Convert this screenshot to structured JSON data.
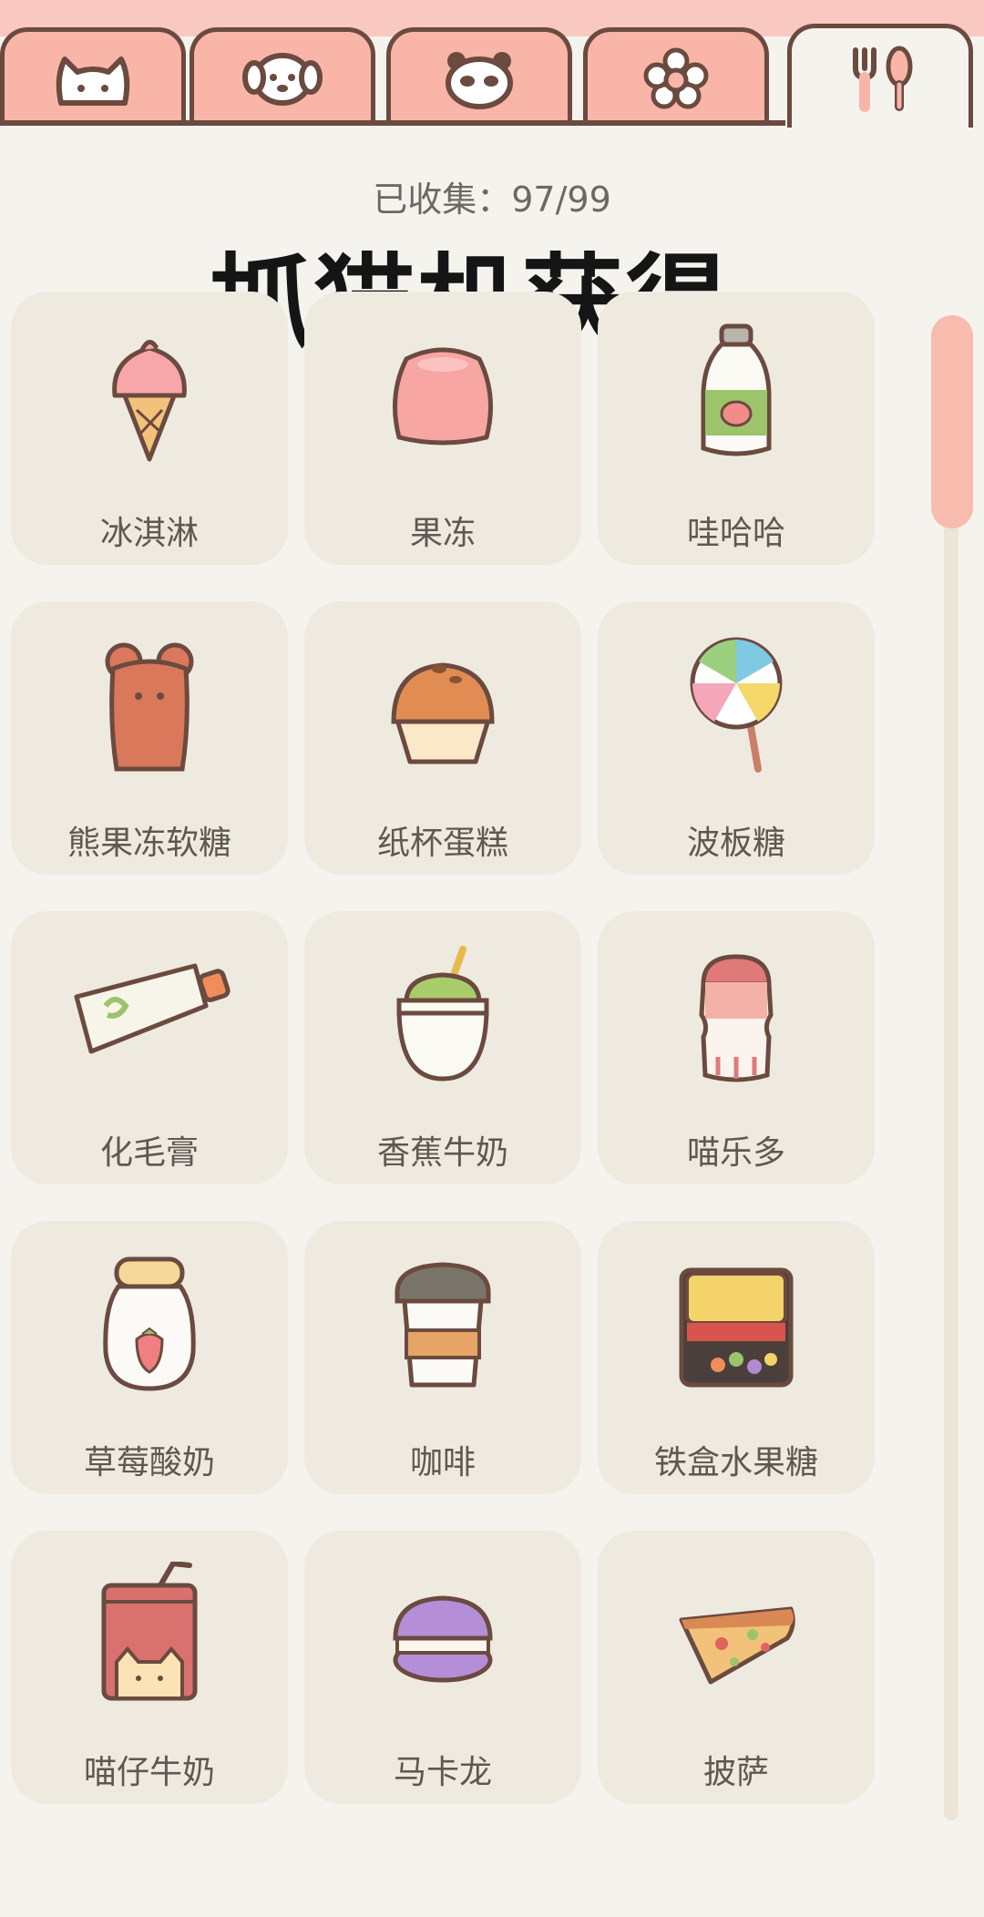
{
  "header": {
    "tabs": [
      {
        "icon": "cat-face-icon"
      },
      {
        "icon": "dog-face-icon"
      },
      {
        "icon": "panda-face-icon"
      },
      {
        "icon": "flower-icon"
      },
      {
        "icon": "fork-spoon-icon",
        "active": true
      }
    ]
  },
  "collection": {
    "count_label": "已收集：97/99",
    "title": "抓猫机获得"
  },
  "items": [
    {
      "name": "冰淇淋",
      "icon": "ice-cream-icon"
    },
    {
      "name": "果冻",
      "icon": "jelly-icon"
    },
    {
      "name": "哇哈哈",
      "icon": "drink-bottle-icon"
    },
    {
      "name": "熊果冻软糖",
      "icon": "gummy-bear-icon"
    },
    {
      "name": "纸杯蛋糕",
      "icon": "cupcake-icon"
    },
    {
      "name": "波板糖",
      "icon": "lollipop-icon"
    },
    {
      "name": "化毛膏",
      "icon": "paste-tube-icon"
    },
    {
      "name": "香蕉牛奶",
      "icon": "banana-milk-icon"
    },
    {
      "name": "喵乐多",
      "icon": "yogurt-drink-icon"
    },
    {
      "name": "草莓酸奶",
      "icon": "strawberry-yogurt-icon"
    },
    {
      "name": "咖啡",
      "icon": "coffee-cup-icon"
    },
    {
      "name": "铁盒水果糖",
      "icon": "candy-tin-icon"
    },
    {
      "name": "喵仔牛奶",
      "icon": "milk-carton-icon"
    },
    {
      "name": "马卡龙",
      "icon": "macaron-icon"
    },
    {
      "name": "披萨",
      "icon": "pizza-slice-icon"
    }
  ],
  "colors": {
    "tab": "#f8b5a8",
    "outline": "#6b4a3f",
    "card": "#efeae0",
    "background": "#f5f3ee",
    "scroll_thumb": "#f8bcaf"
  }
}
